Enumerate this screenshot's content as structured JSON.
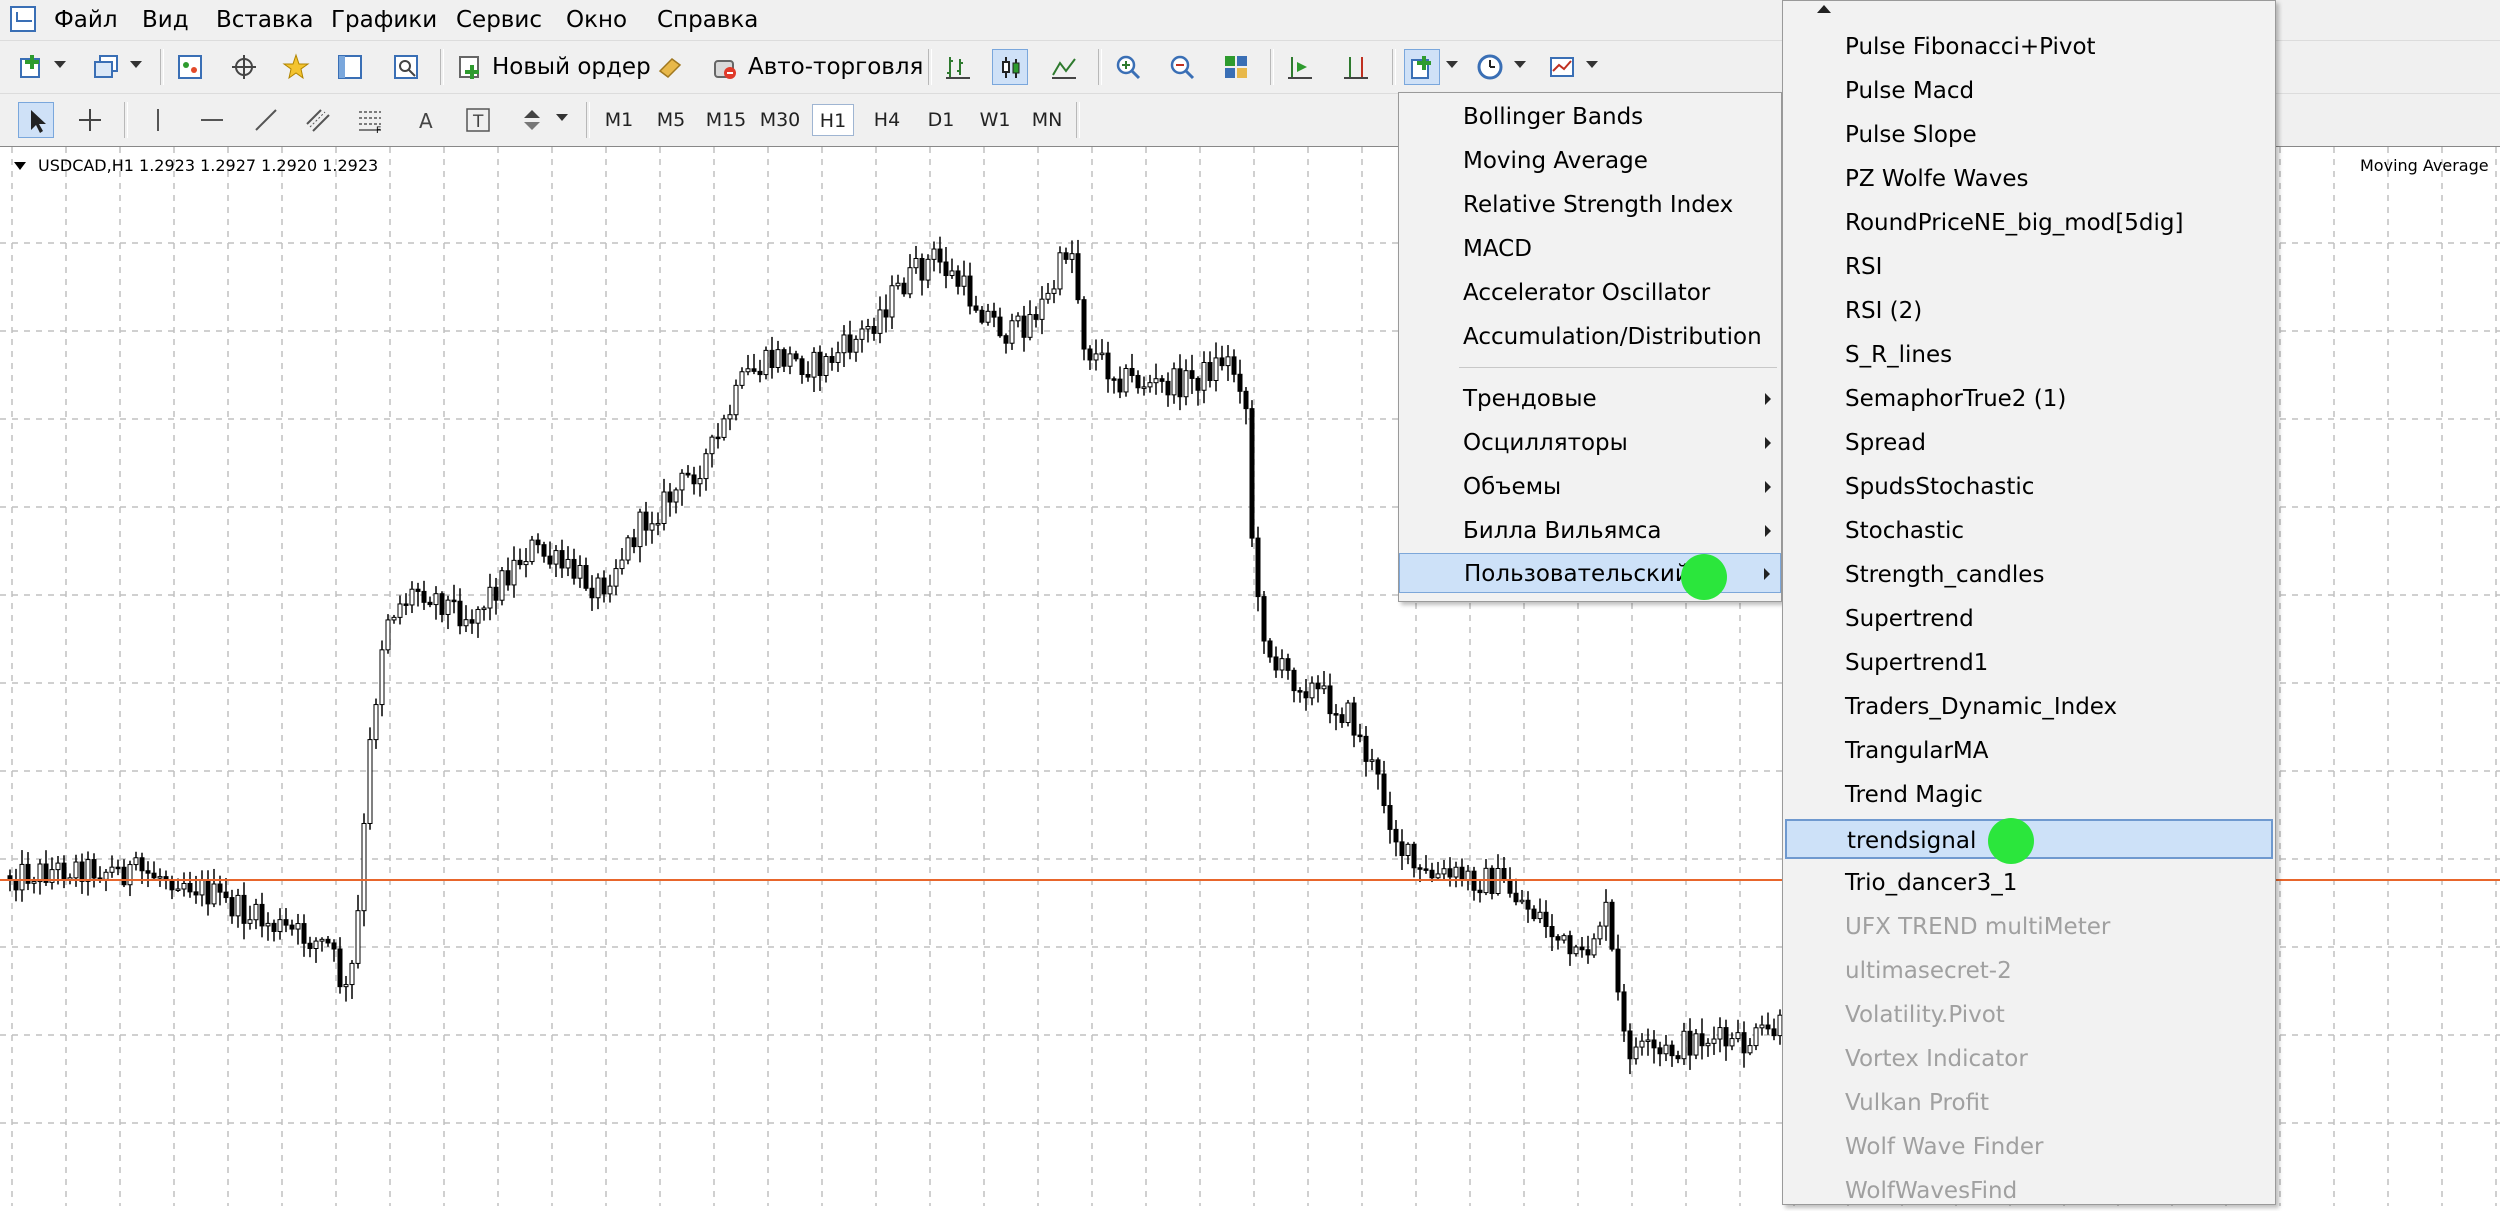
{
  "menubar": {
    "items": [
      "Файл",
      "Вид",
      "Вставка",
      "Графики",
      "Сервис",
      "Окно",
      "Справка"
    ]
  },
  "toolbar": {
    "new_order_label": "Новый ордер",
    "auto_trading_label": "Авто-торговля",
    "timeframes": [
      "M1",
      "M5",
      "M15",
      "M30",
      "H1",
      "H4",
      "D1",
      "W1",
      "MN"
    ],
    "active_timeframe": "H1"
  },
  "chart": {
    "title": "USDCAD,H1  1.2923 1.2927 1.2920 1.2923",
    "indicator_label": "Moving Average",
    "colors": {
      "grid": "#c0c0c0",
      "candle": "#000000",
      "bid_line": "#e8662c",
      "background": "#ffffff"
    }
  },
  "indicator_menu": {
    "items": [
      "Bollinger Bands",
      "Moving Average",
      "Relative Strength Index",
      "MACD",
      "Accelerator Oscillator",
      "Accumulation/Distribution"
    ],
    "categories": [
      "Трендовые",
      "Осцилляторы",
      "Объемы",
      "Билла Вильямса",
      "Пользовательский"
    ],
    "highlighted": "Пользовательский"
  },
  "custom_menu": {
    "items": [
      {
        "label": "Pulse Fibonacci+Pivot",
        "enabled": true
      },
      {
        "label": "Pulse Macd",
        "enabled": true
      },
      {
        "label": "Pulse Slope",
        "enabled": true
      },
      {
        "label": "PZ Wolfe Waves",
        "enabled": true
      },
      {
        "label": "RoundPriceNE_big_mod[5dig]",
        "enabled": true
      },
      {
        "label": "RSI",
        "enabled": true
      },
      {
        "label": "RSI (2)",
        "enabled": true
      },
      {
        "label": "S_R_lines",
        "enabled": true
      },
      {
        "label": "SemaphorTrue2 (1)",
        "enabled": true
      },
      {
        "label": "Spread",
        "enabled": true
      },
      {
        "label": "SpudsStochastic",
        "enabled": true
      },
      {
        "label": "Stochastic",
        "enabled": true
      },
      {
        "label": "Strength_candles",
        "enabled": true
      },
      {
        "label": "Supertrend",
        "enabled": true
      },
      {
        "label": "Supertrend1",
        "enabled": true
      },
      {
        "label": "Traders_Dynamic_Index",
        "enabled": true
      },
      {
        "label": "TrangularMA",
        "enabled": true
      },
      {
        "label": "Trend Magic",
        "enabled": true
      },
      {
        "label": "trendsignal",
        "enabled": true
      },
      {
        "label": "Trio_dancer3_1",
        "enabled": true
      },
      {
        "label": "UFX TREND multiMeter",
        "enabled": false
      },
      {
        "label": "ultimasecret-2",
        "enabled": false
      },
      {
        "label": "Volatility.Pivot",
        "enabled": false
      },
      {
        "label": "Vortex Indicator",
        "enabled": false
      },
      {
        "label": "Vulkan Profit",
        "enabled": false
      },
      {
        "label": "Wolf Wave Finder",
        "enabled": false
      },
      {
        "label": "WolfWavesFind",
        "enabled": false
      }
    ],
    "highlighted": "trendsignal"
  },
  "markers": {
    "color": "#2be63c"
  }
}
